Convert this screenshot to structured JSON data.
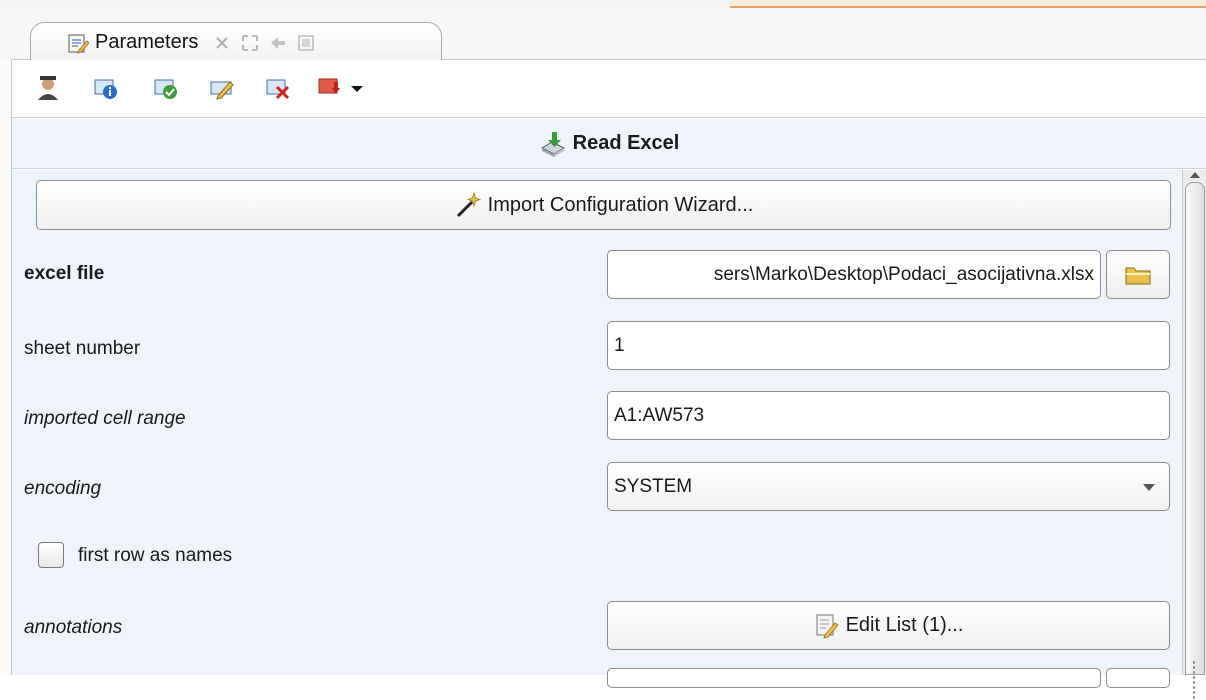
{
  "window": {
    "tab_title": "Parameters",
    "tab_icon": "parameters-icon",
    "tab_controls": [
      "close-icon",
      "maximize-icon",
      "restore-icon",
      "minimize-icon"
    ]
  },
  "toolbar": {
    "buttons": [
      "expert-mode-icon",
      "info-icon",
      "check-icon",
      "edit-icon",
      "delete-icon",
      "export-icon",
      "dropdown-arrow-icon"
    ]
  },
  "operator": {
    "title": "Read Excel",
    "icon": "read-excel-icon"
  },
  "wizard_button": {
    "label": "Import Configuration Wizard...",
    "icon": "wand-icon"
  },
  "params": {
    "excel_file": {
      "label": "excel file",
      "value": "sers\\Marko\\Desktop\\Podaci_asocijativna.xlsx"
    },
    "sheet_number": {
      "label": "sheet number",
      "value": "1"
    },
    "cell_range": {
      "label": "imported cell range",
      "value": "A1:AW573"
    },
    "encoding": {
      "label": "encoding",
      "value": "SYSTEM"
    },
    "first_row": {
      "label": "first row as names",
      "checked": false
    },
    "annotations": {
      "label": "annotations",
      "button": "Edit List (1)..."
    }
  },
  "colors": {
    "panel_bg": "#eef4f9",
    "accent": "#e8a060",
    "border": "#8c8c8c"
  }
}
